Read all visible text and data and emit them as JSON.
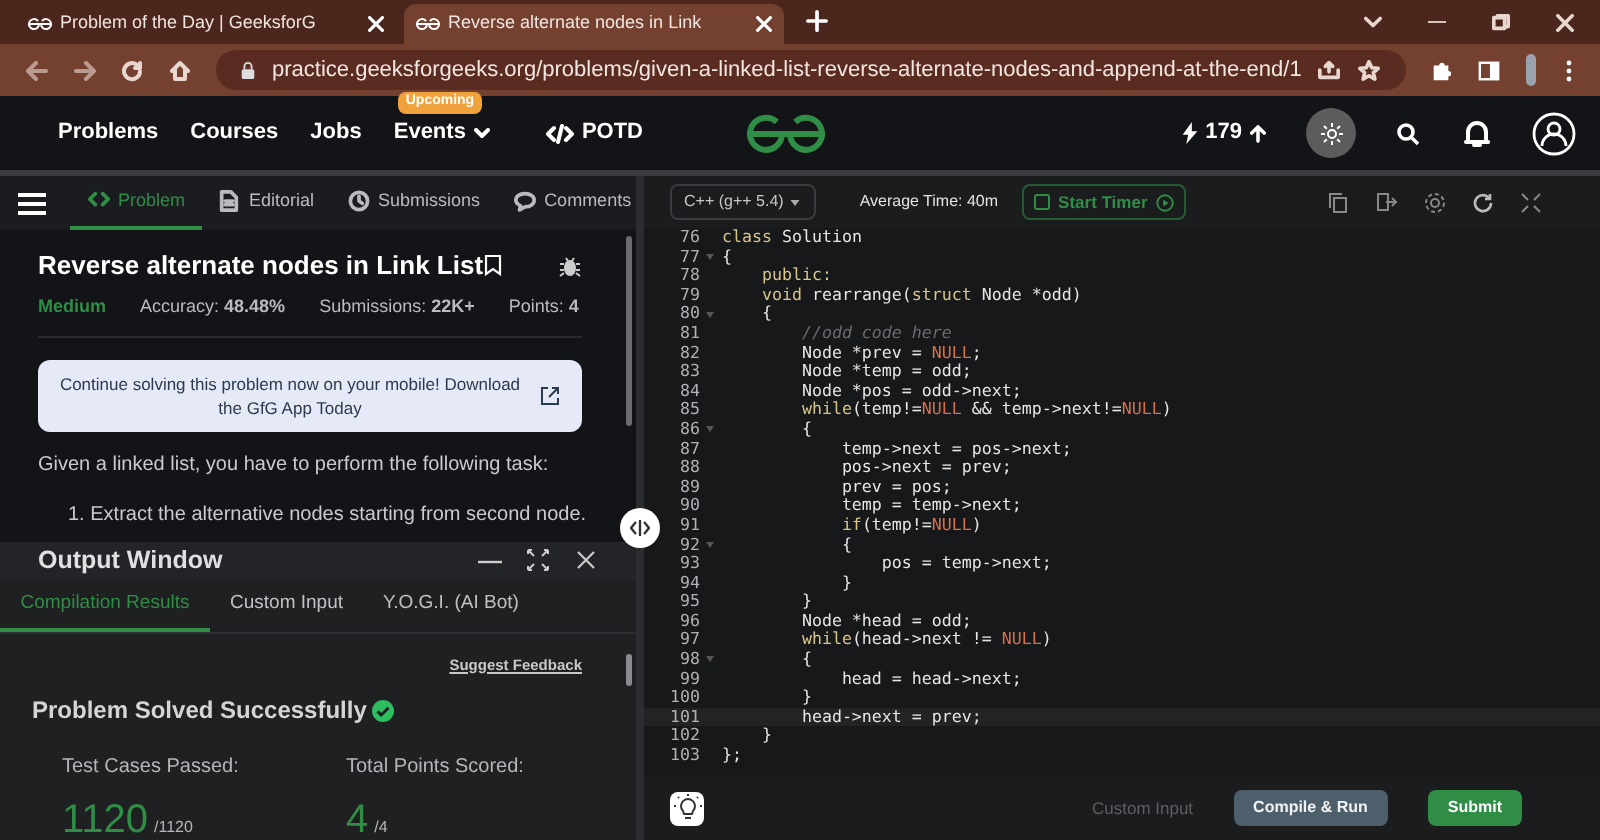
{
  "browser": {
    "tabs": [
      {
        "title": "Problem of the Day | GeeksforG",
        "selected": false
      },
      {
        "title": "Reverse alternate nodes in Link",
        "selected": true
      }
    ],
    "url": "practice.geeksforgeeks.org/problems/given-a-linked-list-reverse-alternate-nodes-and-append-at-the-end/1"
  },
  "nav": {
    "items": [
      {
        "label": "Problems",
        "kind": "link"
      },
      {
        "label": "Courses",
        "kind": "link"
      },
      {
        "label": "Jobs",
        "kind": "link"
      },
      {
        "label": "Events",
        "kind": "dropdown",
        "badge": "Upcoming"
      },
      {
        "label": "POTD",
        "kind": "code"
      }
    ],
    "streak": "179"
  },
  "problem": {
    "tabs": [
      {
        "label": "Problem",
        "selected": true
      },
      {
        "label": "Editorial",
        "selected": false
      },
      {
        "label": "Submissions",
        "selected": false
      },
      {
        "label": "Comments",
        "selected": false
      }
    ],
    "title": "Reverse alternate nodes in Link List",
    "difficulty": "Medium",
    "stats": [
      "Accuracy: **48.48%**",
      "Submissions: **22K+**",
      "Points: **4**"
    ],
    "app_banner": "Continue solving this problem now on your mobile! Download the GfG App Today",
    "description": "Given a linked list, you have to perform the following task:",
    "steps": [
      "1. Extract the alternative nodes starting from second node."
    ]
  },
  "output_window": {
    "title": "Output Window",
    "tabs": [
      {
        "label": "Compilation Results",
        "selected": true
      },
      {
        "label": "Custom Input",
        "selected": false
      },
      {
        "label": "Y.O.G.I. (AI Bot)",
        "selected": false
      }
    ],
    "feedback_link": "Suggest Feedback",
    "status": "Problem Solved Successfully",
    "results": [
      {
        "label": "Test Cases Passed:",
        "value": "1120",
        "total": "/1120"
      },
      {
        "label": "Total Points Scored:",
        "value": "4",
        "total": "/4"
      }
    ]
  },
  "editor": {
    "language": "C++ (g++ 5.4)",
    "average_time": "Average Time: 40m",
    "timer_button": "Start Timer",
    "lines": [
      {
        "number": "76",
        "fold": false,
        "current": false,
        "tokens": [
          {
            "kind": "kw",
            "text": "class"
          },
          {
            "kind": "plain",
            "text": " Solution"
          }
        ]
      },
      {
        "number": "77",
        "fold": true,
        "current": false,
        "tokens": [
          {
            "kind": "plain",
            "text": "{"
          }
        ]
      },
      {
        "number": "78",
        "fold": false,
        "current": false,
        "tokens": [
          {
            "kind": "kw",
            "text": "    public:"
          }
        ]
      },
      {
        "number": "79",
        "fold": false,
        "current": false,
        "tokens": [
          {
            "kind": "kw",
            "text": "    void"
          },
          {
            "kind": "plain",
            "text": " rearrange("
          },
          {
            "kind": "kw",
            "text": "struct"
          },
          {
            "kind": "plain",
            "text": " Node *odd)"
          }
        ]
      },
      {
        "number": "80",
        "fold": true,
        "current": false,
        "tokens": [
          {
            "kind": "plain",
            "text": "    {"
          }
        ]
      },
      {
        "number": "81",
        "fold": false,
        "current": false,
        "tokens": [
          {
            "kind": "comment",
            "text": "        //odd code here"
          }
        ]
      },
      {
        "number": "82",
        "fold": false,
        "current": false,
        "tokens": [
          {
            "kind": "plain",
            "text": "        Node *prev = "
          },
          {
            "kind": "null",
            "text": "NULL"
          },
          {
            "kind": "plain",
            "text": ";"
          }
        ]
      },
      {
        "number": "83",
        "fold": false,
        "current": false,
        "tokens": [
          {
            "kind": "plain",
            "text": "        Node *temp = odd;"
          }
        ]
      },
      {
        "number": "84",
        "fold": false,
        "current": false,
        "tokens": [
          {
            "kind": "plain",
            "text": "        Node *pos = odd->next;"
          }
        ]
      },
      {
        "number": "85",
        "fold": false,
        "current": false,
        "tokens": [
          {
            "kind": "kw",
            "text": "        while"
          },
          {
            "kind": "plain",
            "text": "(temp!="
          },
          {
            "kind": "null",
            "text": "NULL"
          },
          {
            "kind": "plain",
            "text": " && temp->next!="
          },
          {
            "kind": "null",
            "text": "NULL"
          },
          {
            "kind": "plain",
            "text": ")"
          }
        ]
      },
      {
        "number": "86",
        "fold": true,
        "current": false,
        "tokens": [
          {
            "kind": "plain",
            "text": "        {"
          }
        ]
      },
      {
        "number": "87",
        "fold": false,
        "current": false,
        "tokens": [
          {
            "kind": "plain",
            "text": "            temp->next = pos->next;"
          }
        ]
      },
      {
        "number": "88",
        "fold": false,
        "current": false,
        "tokens": [
          {
            "kind": "plain",
            "text": "            pos->next = prev;"
          }
        ]
      },
      {
        "number": "89",
        "fold": false,
        "current": false,
        "tokens": [
          {
            "kind": "plain",
            "text": "            prev = pos;"
          }
        ]
      },
      {
        "number": "90",
        "fold": false,
        "current": false,
        "tokens": [
          {
            "kind": "plain",
            "text": "            temp = temp->next;"
          }
        ]
      },
      {
        "number": "91",
        "fold": false,
        "current": false,
        "tokens": [
          {
            "kind": "kw",
            "text": "            if"
          },
          {
            "kind": "plain",
            "text": "(temp!="
          },
          {
            "kind": "null",
            "text": "NULL"
          },
          {
            "kind": "plain",
            "text": ")"
          }
        ]
      },
      {
        "number": "92",
        "fold": true,
        "current": false,
        "tokens": [
          {
            "kind": "plain",
            "text": "            {"
          }
        ]
      },
      {
        "number": "93",
        "fold": false,
        "current": false,
        "tokens": [
          {
            "kind": "plain",
            "text": "                pos = temp->next;"
          }
        ]
      },
      {
        "number": "94",
        "fold": false,
        "current": false,
        "tokens": [
          {
            "kind": "plain",
            "text": "            }"
          }
        ]
      },
      {
        "number": "95",
        "fold": false,
        "current": false,
        "tokens": [
          {
            "kind": "plain",
            "text": "        }"
          }
        ]
      },
      {
        "number": "96",
        "fold": false,
        "current": false,
        "tokens": [
          {
            "kind": "plain",
            "text": "        Node *head = odd;"
          }
        ]
      },
      {
        "number": "97",
        "fold": false,
        "current": false,
        "tokens": [
          {
            "kind": "kw",
            "text": "        while"
          },
          {
            "kind": "plain",
            "text": "(head->next != "
          },
          {
            "kind": "null",
            "text": "NULL"
          },
          {
            "kind": "plain",
            "text": ")"
          }
        ]
      },
      {
        "number": "98",
        "fold": true,
        "current": false,
        "tokens": [
          {
            "kind": "plain",
            "text": "        {"
          }
        ]
      },
      {
        "number": "99",
        "fold": false,
        "current": false,
        "tokens": [
          {
            "kind": "plain",
            "text": "            head = head->next;"
          }
        ]
      },
      {
        "number": "100",
        "fold": false,
        "current": false,
        "tokens": [
          {
            "kind": "plain",
            "text": "        }"
          }
        ]
      },
      {
        "number": "101",
        "fold": false,
        "current": true,
        "tokens": [
          {
            "kind": "plain",
            "text": "        head->next = prev;"
          }
        ]
      },
      {
        "number": "102",
        "fold": false,
        "current": false,
        "tokens": [
          {
            "kind": "plain",
            "text": "    }"
          }
        ]
      },
      {
        "number": "103",
        "fold": false,
        "current": false,
        "tokens": [
          {
            "kind": "plain",
            "text": "};"
          }
        ]
      }
    ],
    "custom_input": {
      "label": "Custom Input",
      "disabled": true
    },
    "buttons": [
      {
        "label": "Compile & Run",
        "kind": "secondary"
      },
      {
        "label": "Submit",
        "kind": "primary"
      }
    ]
  }
}
